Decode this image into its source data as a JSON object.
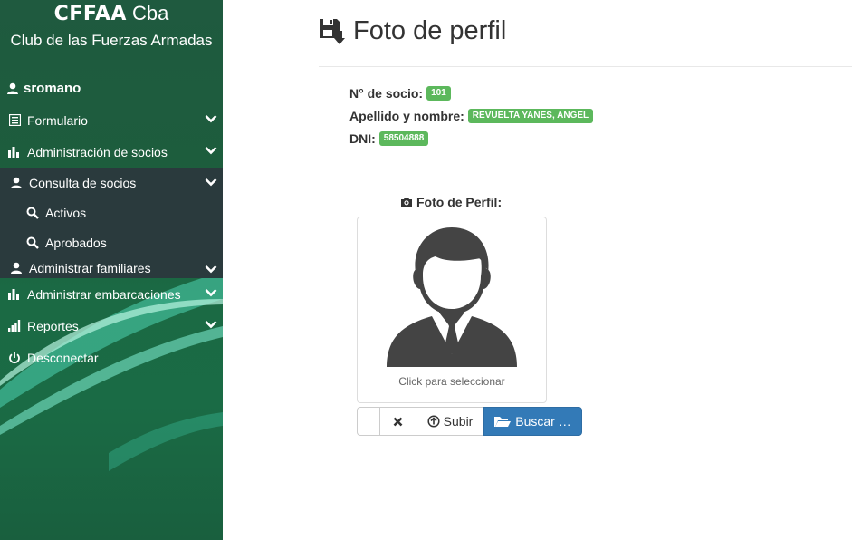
{
  "sidebar": {
    "brand_bold": "CFFAA",
    "brand_light": " Cba",
    "brand_subtitle": "Club de las Fuerzas Armadas",
    "username": "sromano",
    "items": [
      {
        "label": "Formulario",
        "icon": "list-icon"
      },
      {
        "label": "Administración de socios",
        "icon": "bar-chart-icon"
      },
      {
        "label": "Consulta de socios",
        "icon": "user-icon"
      },
      {
        "label": "Activos",
        "icon": "search-icon"
      },
      {
        "label": "Aprobados",
        "icon": "search-icon"
      },
      {
        "label": "Administrar familiares",
        "icon": "user-icon"
      },
      {
        "label": "Administrar embarcaciones",
        "icon": "bar-chart-icon"
      },
      {
        "label": "Reportes",
        "icon": "signal-icon"
      },
      {
        "label": "Desconectar",
        "icon": "power-icon"
      }
    ]
  },
  "main": {
    "title": "Foto de perfil",
    "fields": {
      "socio_label": "N° de socio:",
      "socio_value": "101",
      "nombre_label": "Apellido y nombre:",
      "nombre_value": "REVUELTA YANES, ANGEL",
      "dni_label": "DNI:",
      "dni_value": "58504888"
    },
    "photo_label": "Foto de Perfil:",
    "photo_hint": "Click para seleccionar",
    "buttons": {
      "upload": "Subir",
      "browse": "Buscar …"
    }
  },
  "colors": {
    "sidebar_green": "#1b6a44",
    "badge_green": "#5cb85c",
    "primary_blue": "#337ab7",
    "submenu_dark": "#2a3a3d"
  }
}
